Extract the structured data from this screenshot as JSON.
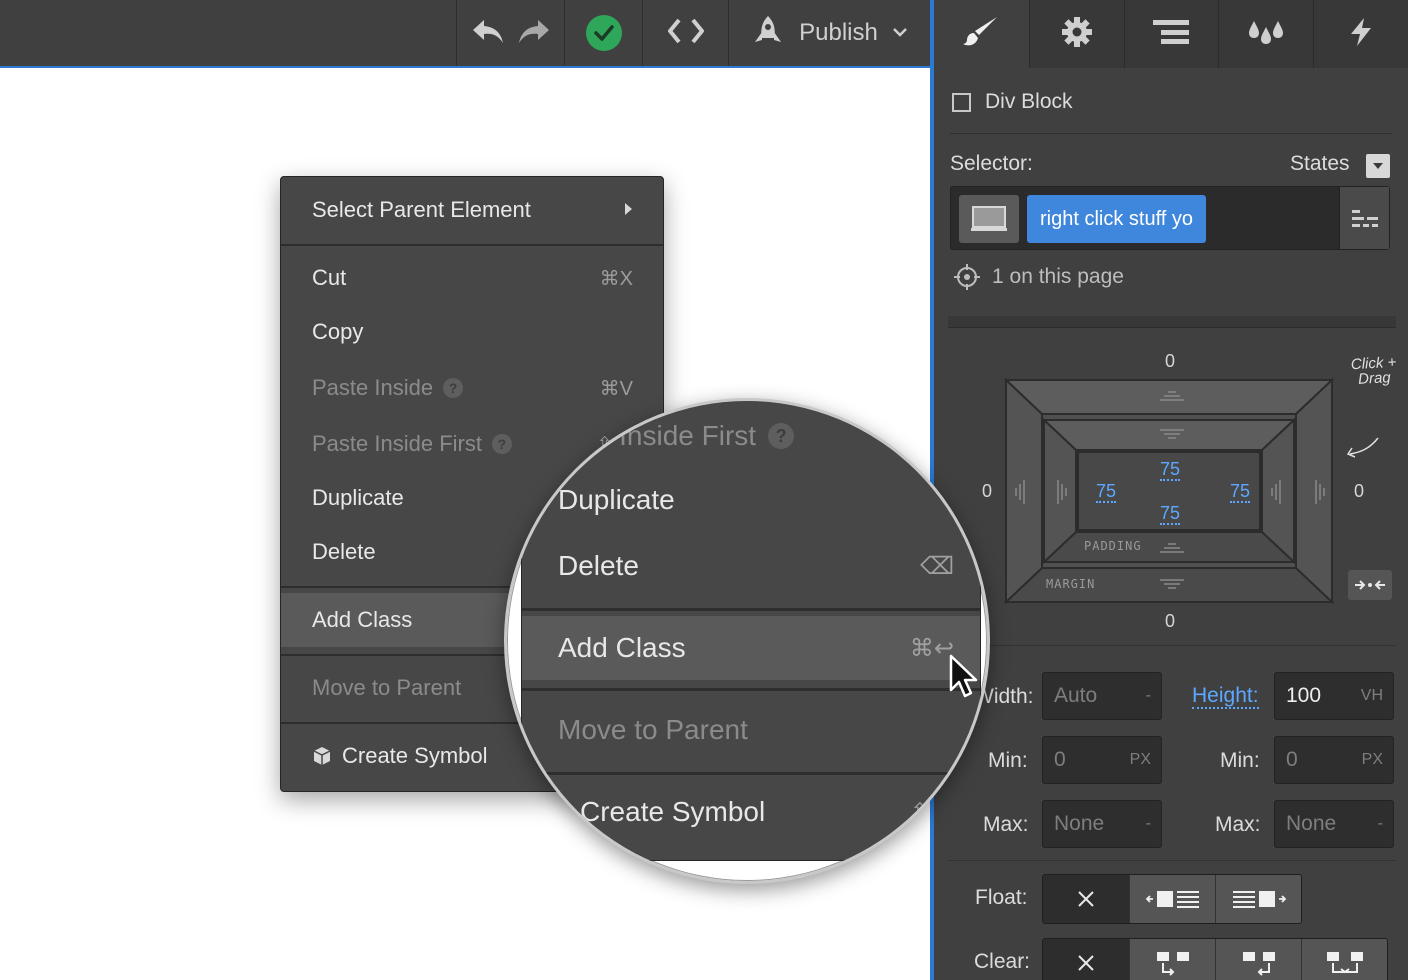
{
  "topbar": {
    "publish_label": "Publish"
  },
  "panel": {
    "tabs": [
      "style-brush-icon",
      "settings-gear-icon",
      "navigator-icon",
      "style-manager-icon",
      "interactions-bolt-icon"
    ],
    "element_type": "Div Block",
    "selector_label": "Selector:",
    "states_label": "States",
    "selector_class": "right click stuff yo",
    "on_page": "1 on this page",
    "hint": "Click + Drag",
    "box_model": {
      "margin_top": "0",
      "margin_right": "0",
      "margin_bottom": "0",
      "margin_left": "0",
      "padding_top": "75",
      "padding_right": "75",
      "padding_bottom": "75",
      "padding_left": "75",
      "margin_word": "MARGIN",
      "padding_word": "PADDING"
    },
    "size": {
      "width_label": "Width:",
      "width_value": "Auto",
      "width_unit": "-",
      "height_label": "Height:",
      "height_value": "100",
      "height_unit": "VH",
      "min_label": "Min:",
      "min_w_value": "0",
      "min_w_unit": "PX",
      "min_h_value": "0",
      "min_h_unit": "PX",
      "max_label": "Max:",
      "max_w_value": "None",
      "max_w_unit": "-",
      "max_h_value": "None",
      "max_h_unit": "-"
    },
    "float_label": "Float:",
    "clear_label": "Clear:"
  },
  "context_menu": {
    "select_parent": "Select Parent Element",
    "cut": "Cut",
    "cut_shortcut": "⌘X",
    "copy": "Copy",
    "paste_inside": "Paste Inside",
    "paste_inside_shortcut": "⌘V",
    "paste_inside_first": "Paste Inside First",
    "paste_inside_first_shortcut": "⇧⌘",
    "duplicate": "Duplicate",
    "delete": "Delete",
    "add_class": "Add Class",
    "move_to_parent": "Move to Parent",
    "create_symbol": "Create Symbol"
  },
  "magnifier": {
    "paste_inside_first_partial": "te Inside First",
    "duplicate": "Duplicate",
    "delete": "Delete",
    "delete_shortcut": "⌫",
    "add_class": "Add Class",
    "add_class_shortcut": "⌘↩",
    "move_to_parent": "Move to Parent",
    "create_symbol": "Create Symbol",
    "create_symbol_shortcut": "⇧⌘"
  },
  "colors": {
    "accent": "#2a7ad6",
    "panel_bg": "#404040",
    "menu_bg": "#474747",
    "publish_ok": "#2fa75a",
    "link_blue": "#5ca8ff"
  }
}
